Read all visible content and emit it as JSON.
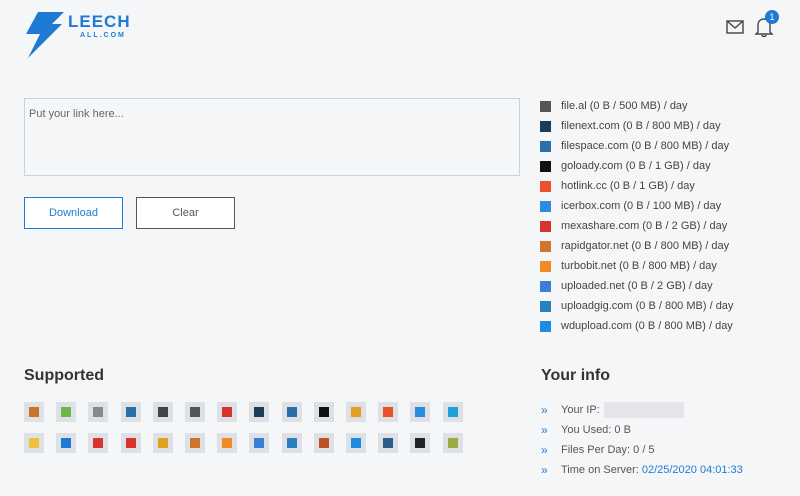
{
  "brand": {
    "name": "LEECH",
    "sub": "ALL.COM",
    "color": "#1f7ad6"
  },
  "header": {
    "mail_icon": "mail-icon",
    "bell_icon": "bell-icon",
    "notification_count": "1"
  },
  "link_input": {
    "placeholder": "Put your link here...",
    "value": ""
  },
  "buttons": {
    "download": "Download",
    "clear": "Clear"
  },
  "hosts": [
    {
      "label": "file.al (0 B / 500 MB) / day",
      "color": "#555"
    },
    {
      "label": "filenext.com (0 B / 800 MB) / day",
      "color": "#1c3d5a"
    },
    {
      "label": "filespace.com (0 B / 800 MB) / day",
      "color": "#2a6fa8"
    },
    {
      "label": "goloady.com (0 B / 1 GB) / day",
      "color": "#111"
    },
    {
      "label": "hotlink.cc (0 B / 1 GB) / day",
      "color": "#e8522c"
    },
    {
      "label": "icerbox.com (0 B / 100 MB) / day",
      "color": "#2d8be0"
    },
    {
      "label": "mexashare.com (0 B / 2 GB) / day",
      "color": "#d9342b"
    },
    {
      "label": "rapidgator.net (0 B / 800 MB) / day",
      "color": "#d0742a"
    },
    {
      "label": "turbobit.net (0 B / 800 MB) / day",
      "color": "#f08a24"
    },
    {
      "label": "uploaded.net (0 B / 2 GB) / day",
      "color": "#3a7fd5"
    },
    {
      "label": "uploadgig.com (0 B / 800 MB) / day",
      "color": "#2a7fc0"
    },
    {
      "label": "wdupload.com (0 B / 800 MB) / day",
      "color": "#1f8be0"
    }
  ],
  "supported": {
    "title": "Supported",
    "icons": [
      {
        "name": "icon-1",
        "color": "#c8742a"
      },
      {
        "name": "icon-2",
        "color": "#6bb84a"
      },
      {
        "name": "icon-3",
        "color": "#888"
      },
      {
        "name": "icon-4",
        "color": "#2a6fa8"
      },
      {
        "name": "icon-5",
        "color": "#444"
      },
      {
        "name": "icon-6",
        "color": "#555"
      },
      {
        "name": "icon-7",
        "color": "#d9342b"
      },
      {
        "name": "icon-8",
        "color": "#1c3d5a"
      },
      {
        "name": "icon-9",
        "color": "#2a6fa8"
      },
      {
        "name": "icon-10",
        "color": "#111"
      },
      {
        "name": "icon-11",
        "color": "#e0a020"
      },
      {
        "name": "icon-12",
        "color": "#e8522c"
      },
      {
        "name": "icon-13",
        "color": "#2d8be0"
      },
      {
        "name": "icon-14",
        "color": "#1fa0d8"
      },
      {
        "name": "icon-15",
        "color": "#f0c040"
      },
      {
        "name": "icon-16",
        "color": "#1f7ad6"
      },
      {
        "name": "icon-17",
        "color": "#d9342b"
      },
      {
        "name": "icon-18",
        "color": "#d9342b"
      },
      {
        "name": "icon-19",
        "color": "#e0a020"
      },
      {
        "name": "icon-20",
        "color": "#d0742a"
      },
      {
        "name": "icon-21",
        "color": "#f08a24"
      },
      {
        "name": "icon-22",
        "color": "#3a7fd5"
      },
      {
        "name": "icon-23",
        "color": "#2a7fc0"
      },
      {
        "name": "icon-24",
        "color": "#c0502a"
      },
      {
        "name": "icon-25",
        "color": "#1f8be0"
      },
      {
        "name": "icon-26",
        "color": "#2a5f8a"
      },
      {
        "name": "icon-27",
        "color": "#222"
      },
      {
        "name": "icon-28",
        "color": "#9aaa40"
      }
    ]
  },
  "your_info": {
    "title": "Your info",
    "ip_label": "Your IP:",
    "used_label": "You Used:",
    "used_value": "0 B",
    "files_label": "Files Per Day:",
    "files_value": "0 / 5",
    "time_label": "Time on Server:",
    "time_value": "02/25/2020 04:01:33"
  }
}
